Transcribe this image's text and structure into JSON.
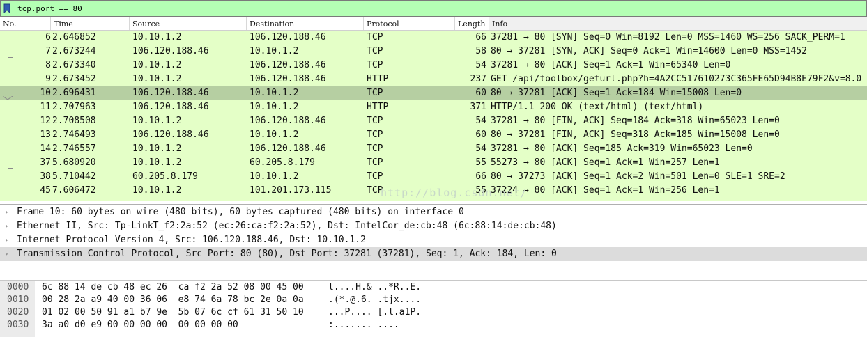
{
  "filter": {
    "value": "tcp.port == 80"
  },
  "columns": [
    "No.",
    "Time",
    "Source",
    "Destination",
    "Protocol",
    "Length",
    "Info"
  ],
  "packets": [
    {
      "no": "6",
      "time": "2.646852",
      "src": "10.10.1.2",
      "dst": "106.120.188.46",
      "proto": "TCP",
      "len": "66",
      "info": "37281 → 80 [SYN] Seq=0 Win=8192 Len=0 MSS=1460 WS=256 SACK_PERM=1"
    },
    {
      "no": "7",
      "time": "2.673244",
      "src": "106.120.188.46",
      "dst": "10.10.1.2",
      "proto": "TCP",
      "len": "58",
      "info": "80 → 37281 [SYN, ACK] Seq=0 Ack=1 Win=14600 Len=0 MSS=1452"
    },
    {
      "no": "8",
      "time": "2.673340",
      "src": "10.10.1.2",
      "dst": "106.120.188.46",
      "proto": "TCP",
      "len": "54",
      "info": "37281 → 80 [ACK] Seq=1 Ack=1 Win=65340 Len=0"
    },
    {
      "no": "9",
      "time": "2.673452",
      "src": "10.10.1.2",
      "dst": "106.120.188.46",
      "proto": "HTTP",
      "len": "237",
      "info": "GET /api/toolbox/geturl.php?h=4A2CC517610273C365FE65D94B8E79F2&v=8.0"
    },
    {
      "no": "10",
      "time": "2.696431",
      "src": "106.120.188.46",
      "dst": "10.10.1.2",
      "proto": "TCP",
      "len": "60",
      "info": "80 → 37281 [ACK] Seq=1 Ack=184 Win=15008 Len=0"
    },
    {
      "no": "11",
      "time": "2.707963",
      "src": "106.120.188.46",
      "dst": "10.10.1.2",
      "proto": "HTTP",
      "len": "371",
      "info": "HTTP/1.1 200 OK  (text/html) (text/html)"
    },
    {
      "no": "12",
      "time": "2.708508",
      "src": "10.10.1.2",
      "dst": "106.120.188.46",
      "proto": "TCP",
      "len": "54",
      "info": "37281 → 80 [FIN, ACK] Seq=184 Ack=318 Win=65023 Len=0"
    },
    {
      "no": "13",
      "time": "2.746493",
      "src": "106.120.188.46",
      "dst": "10.10.1.2",
      "proto": "TCP",
      "len": "60",
      "info": "80 → 37281 [FIN, ACK] Seq=318 Ack=185 Win=15008 Len=0"
    },
    {
      "no": "14",
      "time": "2.746557",
      "src": "10.10.1.2",
      "dst": "106.120.188.46",
      "proto": "TCP",
      "len": "54",
      "info": "37281 → 80 [ACK] Seq=185 Ack=319 Win=65023 Len=0"
    },
    {
      "no": "37",
      "time": "5.680920",
      "src": "10.10.1.2",
      "dst": "60.205.8.179",
      "proto": "TCP",
      "len": "55",
      "info": "55273 → 80 [ACK] Seq=1 Ack=1 Win=257 Len=1"
    },
    {
      "no": "38",
      "time": "5.710442",
      "src": "60.205.8.179",
      "dst": "10.10.1.2",
      "proto": "TCP",
      "len": "66",
      "info": "80 → 37273 [ACK] Seq=1 Ack=2 Win=501 Len=0 SLE=1 SRE=2"
    },
    {
      "no": "45",
      "time": "7.606472",
      "src": "10.10.1.2",
      "dst": "101.201.173.115",
      "proto": "TCP",
      "len": "55",
      "info": "37224 → 80 [ACK] Seq=1 Ack=1 Win=256 Len=1"
    }
  ],
  "selected_packet_no": "10",
  "watermark": "http://blog.csdn.net/",
  "details": [
    {
      "text": "Frame 10: 60 bytes on wire (480 bits), 60 bytes captured (480 bits) on interface 0"
    },
    {
      "text": "Ethernet II, Src: Tp-LinkT_f2:2a:52 (ec:26:ca:f2:2a:52), Dst: IntelCor_de:cb:48 (6c:88:14:de:cb:48)"
    },
    {
      "text": "Internet Protocol Version 4, Src: 106.120.188.46, Dst: 10.10.1.2"
    },
    {
      "text": "Transmission Control Protocol, Src Port: 80 (80), Dst Port: 37281 (37281), Seq: 1, Ack: 184, Len: 0"
    }
  ],
  "bytes": [
    {
      "offset": "0000",
      "hex": "6c 88 14 de cb 48 ec 26  ca f2 2a 52 08 00 45 00",
      "ascii": "l....H.& ..*R..E."
    },
    {
      "offset": "0010",
      "hex": "00 28 2a a9 40 00 36 06  e8 74 6a 78 bc 2e 0a 0a",
      "ascii": ".(*.@.6. .tjx...."
    },
    {
      "offset": "0020",
      "hex": "01 02 00 50 91 a1 b7 9e  5b 07 6c cf 61 31 50 10",
      "ascii": "...P.... [.l.a1P."
    },
    {
      "offset": "0030",
      "hex": "3a a0 d0 e9 00 00 00 00  00 00 00 00",
      "ascii": ":....... ...."
    }
  ],
  "colors": {
    "filter_ok": "#b4ffb4",
    "tcp_row": "#e4ffc7",
    "selected_row": "#b6cfa2"
  },
  "icons": {
    "bookmark": "bookmark-icon",
    "expand": "chevron-right-icon"
  }
}
